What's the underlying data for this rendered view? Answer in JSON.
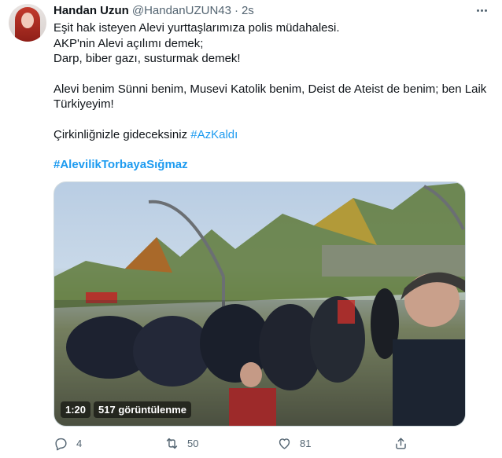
{
  "tweet": {
    "author_name": "Handan Uzun",
    "author_handle": "@HandanUZUN43",
    "separator": "·",
    "time": "2s",
    "lines": [
      "Eşit hak isteyen Alevi yurttaşlarımıza polis müdahalesi.",
      "AKP'nin Alevi açılımı demek;",
      "Darp, biber gazı, susturmak demek!",
      "Alevi benim Sünni benim, Musevi Katolik benim, Deist de Ateist de benim; ben Laik",
      "Türkiyeyim!",
      "Çirkinliğnizle gideceksiniz"
    ],
    "hashtag_inline": "#AzKaldı",
    "hashtag_bold": "#AlevilikTorbayaSığmaz"
  },
  "video": {
    "duration": "1:20",
    "views": "517 görüntülenme"
  },
  "actions": {
    "reply_count": "4",
    "retweet_count": "50",
    "like_count": "81"
  },
  "icons": {
    "more": "more-dots-icon",
    "reply": "reply-icon",
    "retweet": "retweet-icon",
    "like": "heart-icon",
    "share": "share-icon"
  },
  "colors": {
    "accent": "#1d9bf0",
    "text": "#0f1419",
    "muted": "#536471"
  }
}
